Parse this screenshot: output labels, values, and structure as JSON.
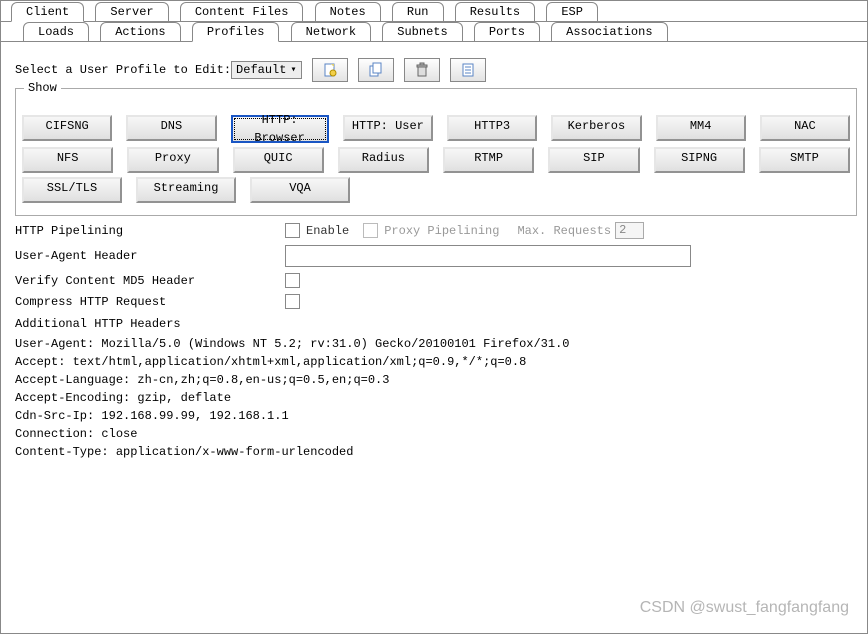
{
  "tabs": {
    "primary": [
      "Client",
      "Server",
      "Content Files",
      "Notes",
      "Run",
      "Results",
      "ESP"
    ],
    "secondary": [
      "Loads",
      "Actions",
      "Profiles",
      "Network",
      "Subnets",
      "Ports",
      "Associations"
    ]
  },
  "profile": {
    "selectLabel": "Select a User Profile to Edit:",
    "selected": "Default"
  },
  "show": {
    "legend": "Show",
    "rows": [
      [
        "CIFSNG",
        "DNS",
        "HTTP: Browser",
        "HTTP: User",
        "HTTP3",
        "Kerberos",
        "MM4",
        "NAC"
      ],
      [
        "NFS",
        "Proxy",
        "QUIC",
        "Radius",
        "RTMP",
        "SIP",
        "SIPNG",
        "SMTP"
      ],
      [
        "SSL/TLS",
        "Streaming",
        "VQA"
      ]
    ],
    "selected": "HTTP: Browser"
  },
  "form": {
    "pipelining": {
      "label": "HTTP Pipelining",
      "enable": "Enable",
      "proxy": "Proxy Pipelining",
      "maxLabel": "Max. Requests",
      "maxVal": "2"
    },
    "userAgent": {
      "label": "User-Agent Header",
      "value": ""
    },
    "verifyMd5": {
      "label": "Verify Content MD5 Header"
    },
    "compress": {
      "label": "Compress HTTP Request"
    }
  },
  "headers": {
    "title": "Additional HTTP Headers",
    "lines": [
      "User-Agent: Mozilla/5.0 (Windows NT 5.2; rv:31.0) Gecko/20100101 Firefox/31.0",
      "Accept: text/html,application/xhtml+xml,application/xml;q=0.9,*/*;q=0.8",
      "Accept-Language: zh-cn,zh;q=0.8,en-us;q=0.5,en;q=0.3",
      "Accept-Encoding: gzip, deflate",
      "Cdn-Src-Ip: 192.168.99.99, 192.168.1.1",
      "Connection: close",
      "Content-Type: application/x-www-form-urlencoded"
    ]
  },
  "watermark": "CSDN @swust_fangfangfang"
}
